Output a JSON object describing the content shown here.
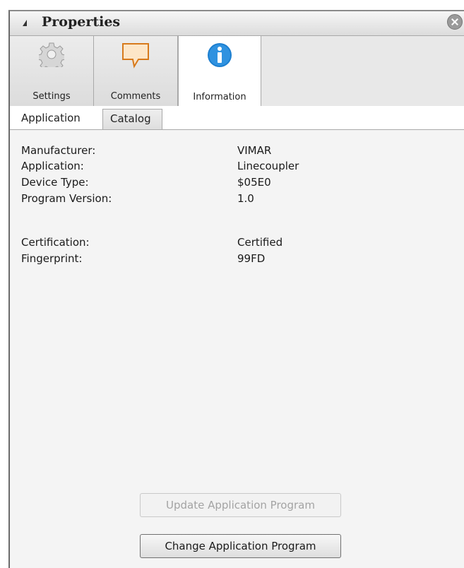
{
  "panel": {
    "title": "Properties"
  },
  "big_tabs": [
    {
      "label": "Settings",
      "icon": "gear-icon"
    },
    {
      "label": "Comments",
      "icon": "comment-icon"
    },
    {
      "label": "Information",
      "icon": "info-icon"
    }
  ],
  "sub_tabs": [
    {
      "label": "Application"
    },
    {
      "label": "Catalog"
    }
  ],
  "info": [
    {
      "key": "Manufacturer:",
      "value": "VIMAR"
    },
    {
      "key": "Application:",
      "value": "Linecoupler"
    },
    {
      "key": "Device Type:",
      "value": "$05E0"
    },
    {
      "key": "Program Version:",
      "value": "1.0"
    },
    {
      "key": "Certification:",
      "value": "Certified"
    },
    {
      "key": "Fingerprint:",
      "value": "99FD"
    }
  ],
  "buttons": {
    "update_label": "Update Application Program",
    "change_label": "Change Application Program"
  },
  "colors": {
    "info_blue": "#1d7fd0",
    "comment_orange": "#f5a64a"
  }
}
